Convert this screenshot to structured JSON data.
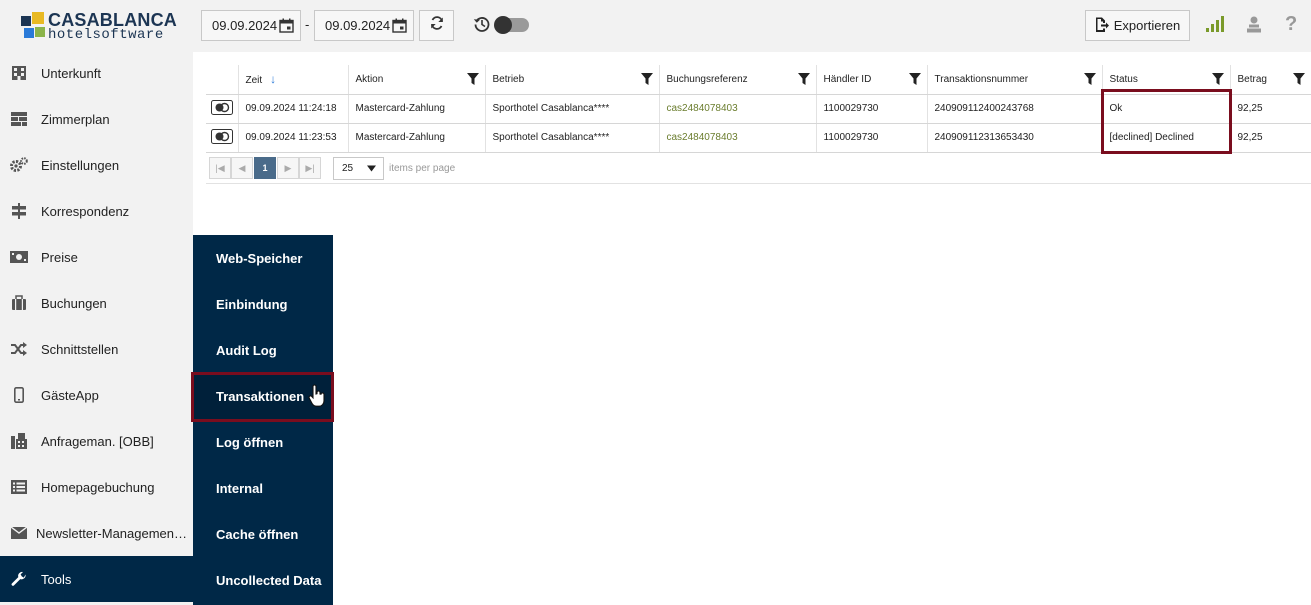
{
  "logo": {
    "brand": "CASABLANCA",
    "sub": "hotelsoftware"
  },
  "sidebar": {
    "items": [
      {
        "label": "Unterkunft",
        "icon": "building-icon"
      },
      {
        "label": "Zimmerplan",
        "icon": "grid-plan-icon"
      },
      {
        "label": "Einstellungen",
        "icon": "gears-icon"
      },
      {
        "label": "Korrespondenz",
        "icon": "signpost-icon"
      },
      {
        "label": "Preise",
        "icon": "money-icon"
      },
      {
        "label": "Buchungen",
        "icon": "suitcase-icon"
      },
      {
        "label": "Schnittstellen",
        "icon": "shuffle-icon"
      },
      {
        "label": "GästeApp",
        "icon": "mobile-icon"
      },
      {
        "label": "Anfrageman. [OBB]",
        "icon": "fax-icon"
      },
      {
        "label": "Homepagebuchung",
        "icon": "list-icon"
      },
      {
        "label": "Newsletter-Managemen…",
        "icon": "envelope-icon"
      },
      {
        "label": "Tools",
        "icon": "wrench-icon"
      }
    ]
  },
  "submenu": {
    "items": [
      {
        "label": "Web-Speicher"
      },
      {
        "label": "Einbindung"
      },
      {
        "label": "Audit Log"
      },
      {
        "label": "Transaktionen"
      },
      {
        "label": "Log öffnen"
      },
      {
        "label": "Internal"
      },
      {
        "label": "Cache öffnen"
      },
      {
        "label": "Uncollected Data"
      }
    ]
  },
  "toolbar": {
    "date_from": "09.09.2024",
    "date_to": "09.09.2024",
    "separator": "-",
    "export_label": "Exportieren"
  },
  "grid": {
    "headers": [
      "Zeit",
      "Aktion",
      "Betrieb",
      "Buchungsreferenz",
      "Händler ID",
      "Transaktionsnummer",
      "Status",
      "Betrag"
    ],
    "rows": [
      {
        "zeit": "09.09.2024 11:24:18",
        "aktion": "Mastercard-Zahlung",
        "betrieb": "Sporthotel Casablanca****",
        "ref": "cas2484078403",
        "haendler": "1100029730",
        "tnr": "240909112400243768",
        "status": "Ok",
        "betrag": "92,25"
      },
      {
        "zeit": "09.09.2024 11:23:53",
        "aktion": "Mastercard-Zahlung",
        "betrieb": "Sporthotel Casablanca****",
        "ref": "cas2484078403",
        "haendler": "1100029730",
        "tnr": "240909112313653430",
        "status": "[declined] Declined",
        "betrag": "92,25"
      }
    ]
  },
  "pager": {
    "current_page": "1",
    "page_size": "25",
    "page_size_label": "items per page"
  },
  "colors": {
    "sidebar_bg": "#f2f2f2",
    "submenu_bg": "#002847",
    "highlight": "#7a0d1e",
    "link": "#6b7d2e"
  }
}
